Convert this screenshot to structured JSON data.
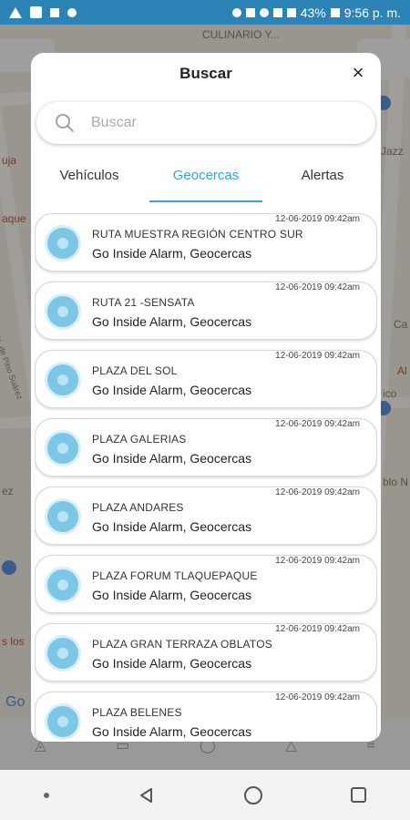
{
  "status_bar": {
    "battery": "43%",
    "time": "9:56 p. m."
  },
  "map": {
    "labels": [
      "CULINARIO Y...",
      "uja",
      "aque",
      "Calz. de Pino Suárez",
      "Jazz",
      "Ca",
      "Al",
      "ico",
      "blo N",
      "ez",
      "s los",
      "Go"
    ]
  },
  "modal": {
    "title": "Buscar",
    "close_label": "×",
    "search_placeholder": "Buscar",
    "tabs": [
      {
        "label": "Vehículos",
        "active": false
      },
      {
        "label": "Geocercas",
        "active": true
      },
      {
        "label": "Alertas",
        "active": false
      }
    ],
    "items": [
      {
        "name": "RUTA MUESTRA REGIÓN CENTRO SUR",
        "subtitle": "Go Inside Alarm, Geocercas",
        "time": "12-06-2019 09:42am"
      },
      {
        "name": "RUTA 21 -SENSATA",
        "subtitle": "Go Inside Alarm, Geocercas",
        "time": "12-06-2019 09:42am"
      },
      {
        "name": "PLAZA DEL SOL",
        "subtitle": "Go Inside Alarm, Geocercas",
        "time": "12-06-2019 09:42am"
      },
      {
        "name": "PLAZA GALERIAS",
        "subtitle": "Go Inside Alarm, Geocercas",
        "time": "12-06-2019 09:42am"
      },
      {
        "name": "PLAZA ANDARES",
        "subtitle": "Go Inside Alarm, Geocercas",
        "time": "12-06-2019 09:42am"
      },
      {
        "name": "PLAZA FORUM TLAQUEPAQUE",
        "subtitle": "Go Inside Alarm, Geocercas",
        "time": "12-06-2019 09:42am"
      },
      {
        "name": "PLAZA GRAN TERRAZA OBLATOS",
        "subtitle": "Go Inside Alarm, Geocercas",
        "time": "12-06-2019 09:42am"
      },
      {
        "name": "PLAZA BELENES",
        "subtitle": "Go Inside Alarm, Geocercas",
        "time": "12-06-2019 09:42am"
      }
    ]
  },
  "colors": {
    "status_bar": "#2b83b6",
    "accent": "#3aa3d8",
    "avatar": "#7cc6e6"
  }
}
